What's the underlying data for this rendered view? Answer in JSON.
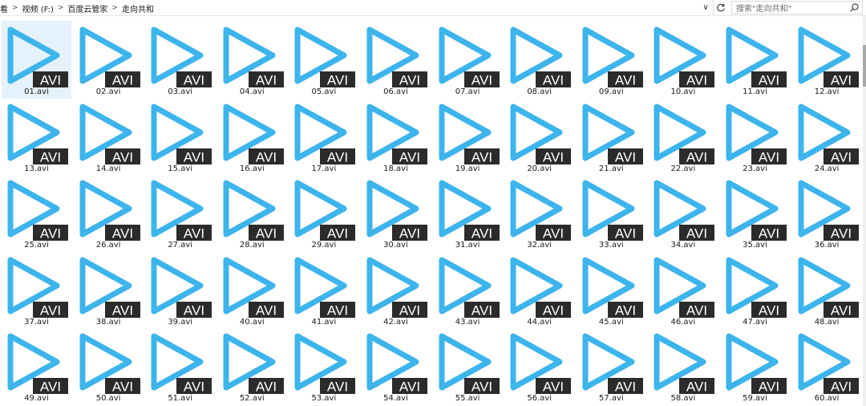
{
  "address_bar": {
    "crumbs": [
      "视频 (F:)",
      "百度云管家",
      "走向共和"
    ],
    "partial_first": "看"
  },
  "search": {
    "placeholder": "搜索\"走向共和\""
  },
  "icon": {
    "badge_text": "AVI",
    "play_color": "#3db4ec",
    "badge_color": "#2b2b2b"
  },
  "files": [
    "01.avi",
    "02.avi",
    "03.avi",
    "04.avi",
    "05.avi",
    "06.avi",
    "07.avi",
    "08.avi",
    "09.avi",
    "10.avi",
    "11.avi",
    "12.avi",
    "13.avi",
    "14.avi",
    "15.avi",
    "16.avi",
    "17.avi",
    "18.avi",
    "19.avi",
    "20.avi",
    "21.avi",
    "22.avi",
    "23.avi",
    "24.avi",
    "25.avi",
    "26.avi",
    "27.avi",
    "28.avi",
    "29.avi",
    "30.avi",
    "31.avi",
    "32.avi",
    "33.avi",
    "34.avi",
    "35.avi",
    "36.avi",
    "37.avi",
    "38.avi",
    "39.avi",
    "40.avi",
    "41.avi",
    "42.avi",
    "43.avi",
    "44.avi",
    "45.avi",
    "46.avi",
    "47.avi",
    "48.avi",
    "49.avi",
    "50.avi",
    "51.avi",
    "52.avi",
    "53.avi",
    "54.avi",
    "55.avi",
    "56.avi",
    "57.avi",
    "58.avi",
    "59.avi",
    "60.avi"
  ],
  "selected_index": 0
}
